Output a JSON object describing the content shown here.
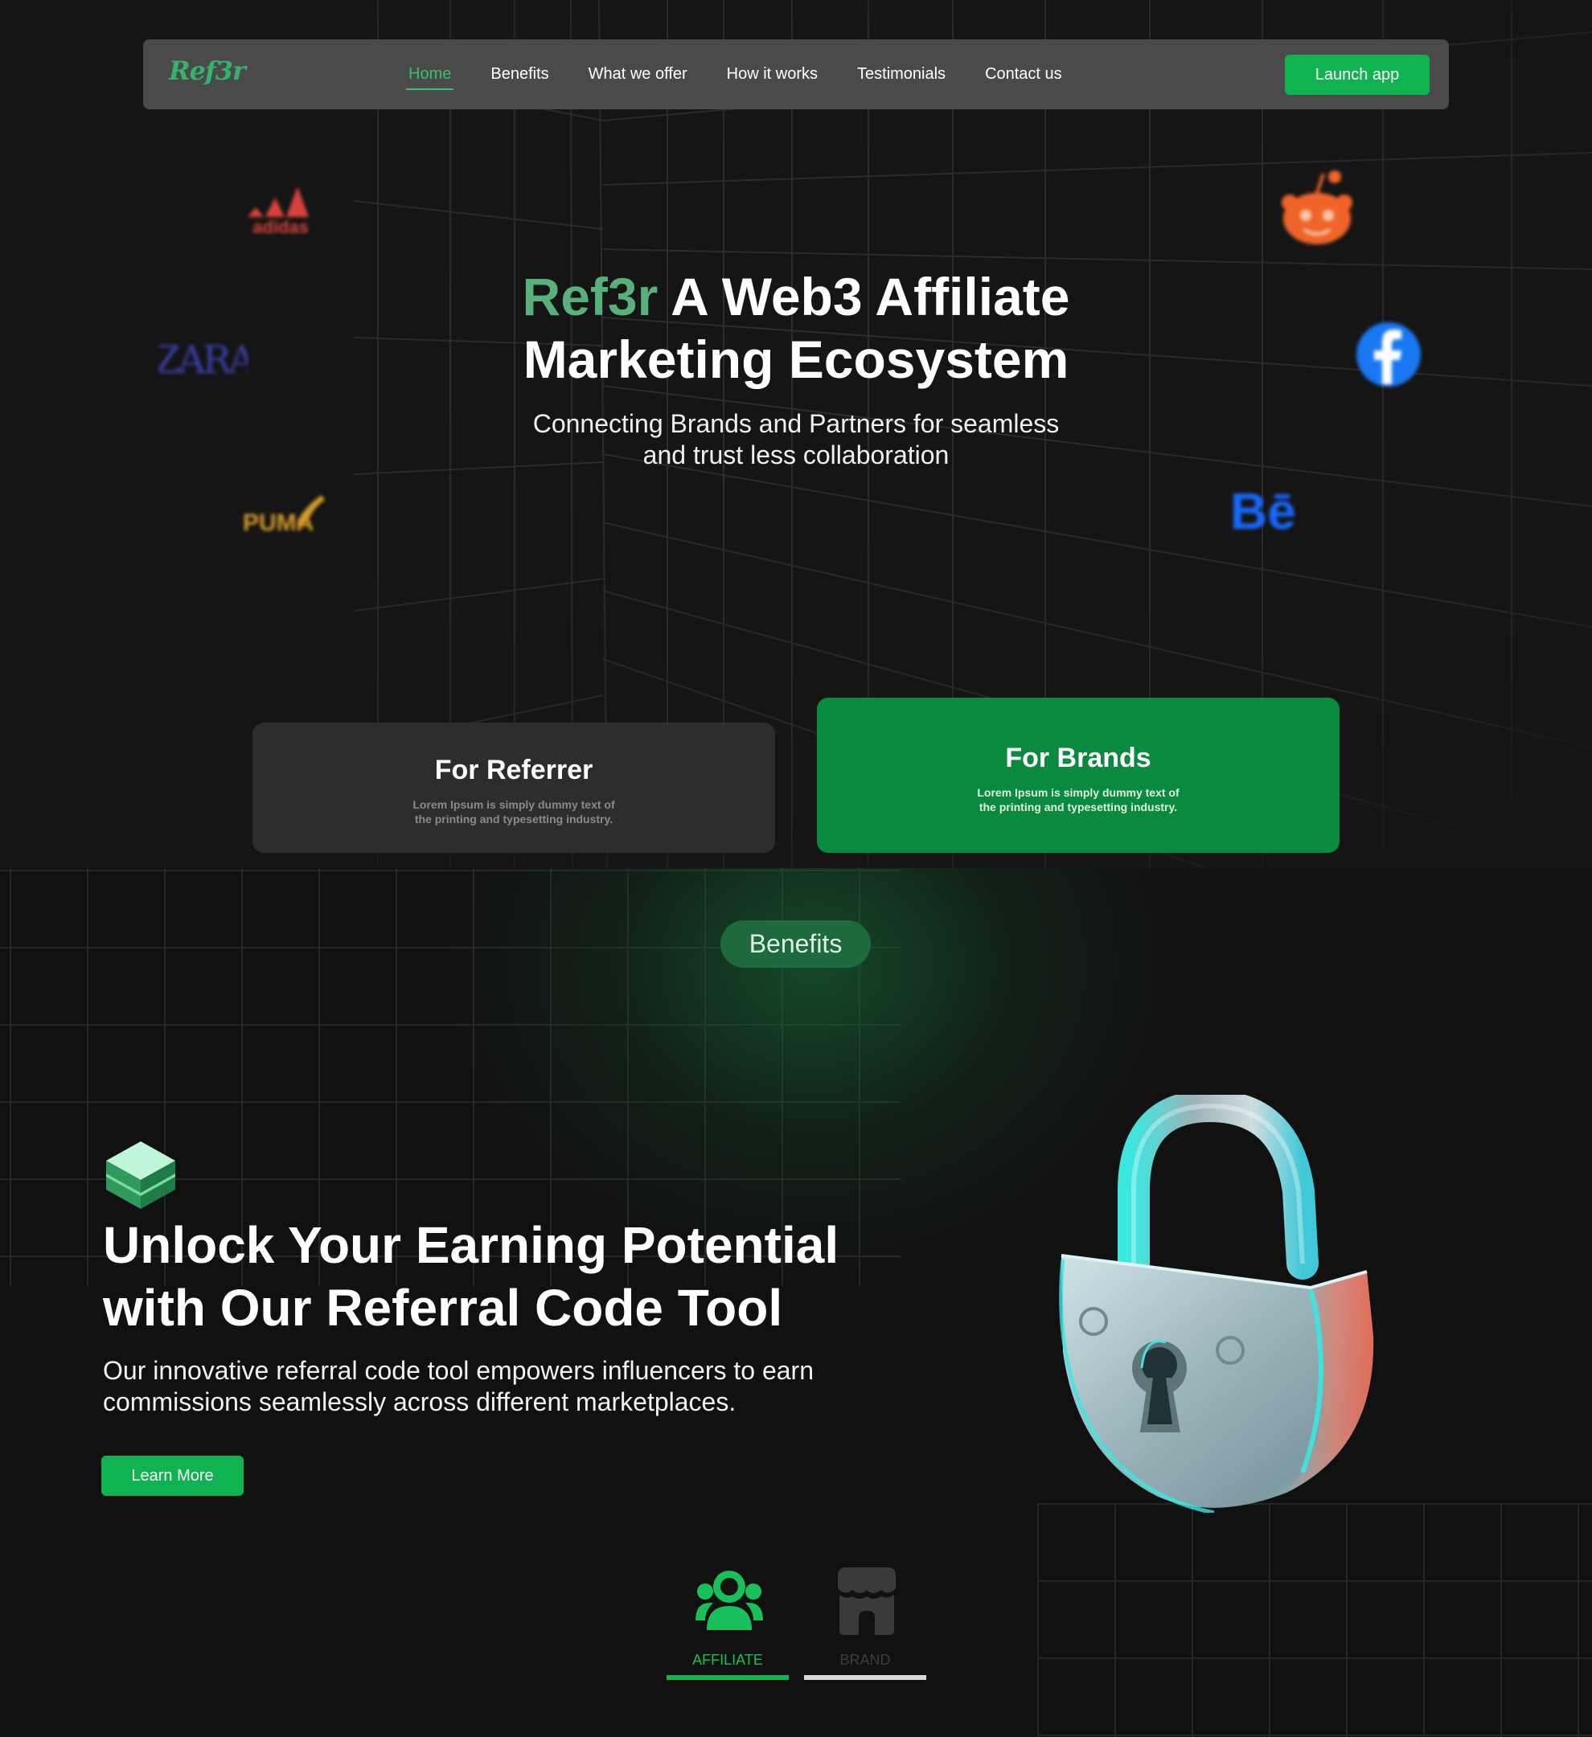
{
  "nav": {
    "logo": "Ref3r",
    "links": [
      {
        "label": "Home",
        "active": true
      },
      {
        "label": "Benefits",
        "active": false
      },
      {
        "label": "What we offer",
        "active": false
      },
      {
        "label": "How it works",
        "active": false
      },
      {
        "label": "Testimonials",
        "active": false
      },
      {
        "label": "Contact us",
        "active": false
      }
    ],
    "launch_label": "Launch app"
  },
  "hero": {
    "title_accent": "Ref3r",
    "title_rest_line1": " A Web3 Affiliate",
    "title_line2": "Marketing Ecosystem",
    "subtitle_line1": "Connecting Brands and Partners for seamless",
    "subtitle_line2": "and trust less collaboration",
    "brand_logos": [
      {
        "name": "adidas-logo",
        "text": "adidas",
        "color": "#d9423a"
      },
      {
        "name": "zara-logo",
        "text": "ZARA",
        "color": "#3b3fa6"
      },
      {
        "name": "puma-logo",
        "text": "PUMA",
        "color": "#d59a2a"
      },
      {
        "name": "reddit-logo",
        "color": "#f0642a"
      },
      {
        "name": "facebook-logo",
        "color": "#1877f2"
      },
      {
        "name": "behance-logo",
        "text": "Bē",
        "color": "#1769ff"
      }
    ]
  },
  "cards": {
    "referrer": {
      "title": "For Referrer",
      "desc_line1": "Lorem Ipsum is simply dummy text of",
      "desc_line2": "the printing and typesetting industry."
    },
    "brands": {
      "title": "For Brands",
      "desc_line1": "Lorem Ipsum is simply dummy text of",
      "desc_line2": "the printing and typesetting industry."
    }
  },
  "benefits": {
    "pill": "Benefits",
    "title_line1": "Unlock Your Earning Potential",
    "title_line2": "with Our Referral Code Tool",
    "desc_line1": "Our innovative referral code tool empowers influencers to earn",
    "desc_line2": "commissions seamlessly across different marketplaces.",
    "learn_more": "Learn More",
    "tabs": [
      {
        "label": "AFFILIATE",
        "active": true,
        "icon": "users-icon"
      },
      {
        "label": "BRAND",
        "active": false,
        "icon": "store-icon"
      }
    ]
  },
  "colors": {
    "accent_green": "#10b34f",
    "background": "#121212",
    "nav_bg": "#4a4a4a",
    "brands_card": "#0a8a3e"
  }
}
